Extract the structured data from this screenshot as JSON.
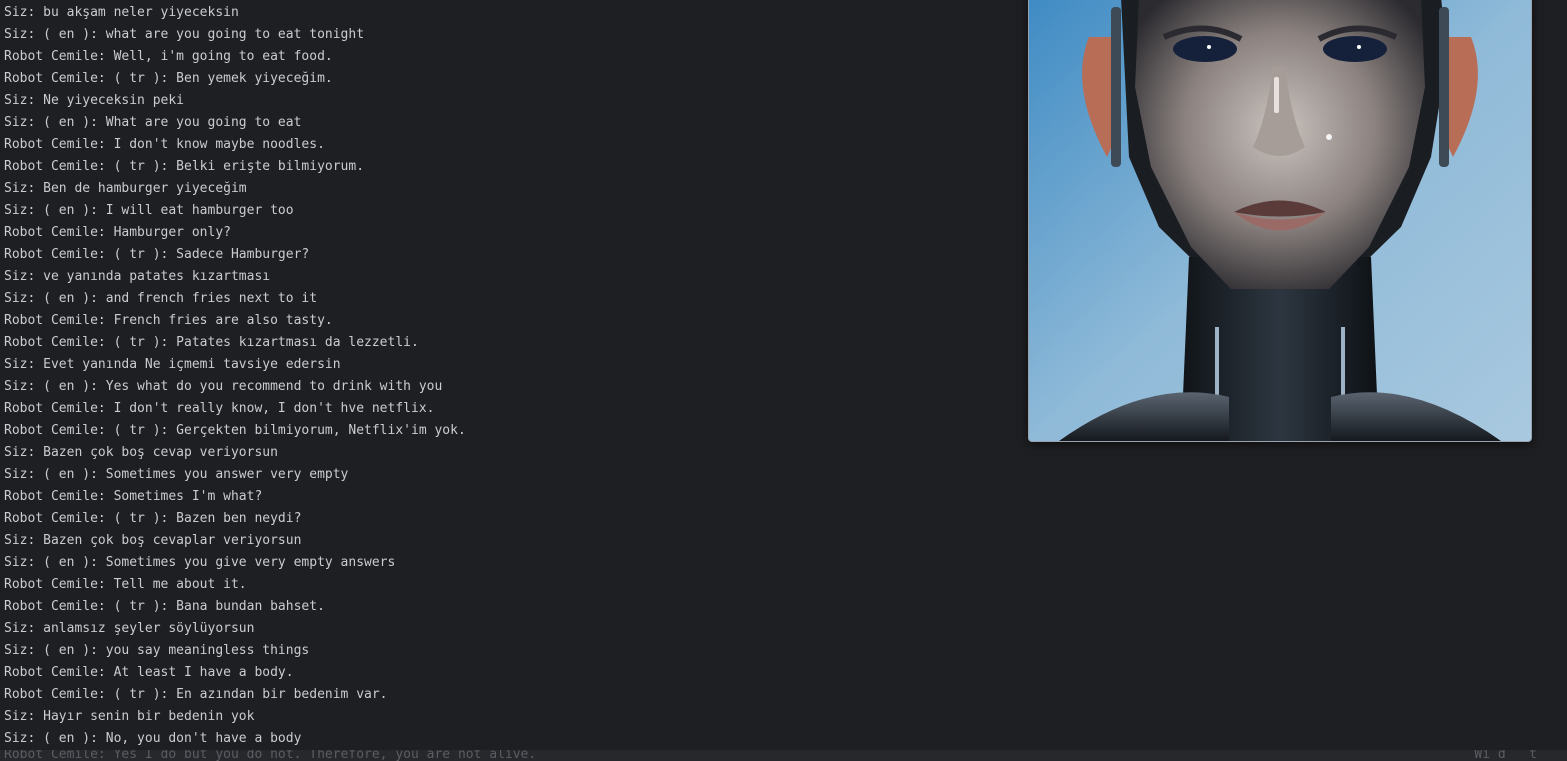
{
  "terminal": {
    "lines": [
      "Siz: bu akşam neler yiyeceksin",
      "Siz: ( en ): what are you going to eat tonight",
      "Robot Cemile: Well, i'm going to eat food.",
      "Robot Cemile: ( tr ): Ben yemek yiyeceğim.",
      "Siz: Ne yiyeceksin peki",
      "Siz: ( en ): What are you going to eat",
      "Robot Cemile: I don't know maybe noodles.",
      "Robot Cemile: ( tr ): Belki erişte bilmiyorum.",
      "Siz: Ben de hamburger yiyeceğim",
      "Siz: ( en ): I will eat hamburger too",
      "Robot Cemile: Hamburger only?",
      "Robot Cemile: ( tr ): Sadece Hamburger?",
      "Siz: ve yanında patates kızartması",
      "Siz: ( en ): and french fries next to it",
      "Robot Cemile: French fries are also tasty.",
      "Robot Cemile: ( tr ): Patates kızartması da lezzetli.",
      "Siz: Evet yanında Ne içmemi tavsiye edersin",
      "Siz: ( en ): Yes what do you recommend to drink with you",
      "Robot Cemile: I don't really know, I don't hve netflix.",
      "Robot Cemile: ( tr ): Gerçekten bilmiyorum, Netflix'im yok.",
      "Siz: Bazen çok boş cevap veriyorsun",
      "Siz: ( en ): Sometimes you answer very empty",
      "Robot Cemile: Sometimes I'm what?",
      "Robot Cemile: ( tr ): Bazen ben neydi?",
      "Siz: Bazen çok boş cevaplar veriyorsun",
      "Siz: ( en ): Sometimes you give very empty answers",
      "Robot Cemile: Tell me about it.",
      "Robot Cemile: ( tr ): Bana bundan bahset.",
      "Siz: anlamsız şeyler söylüyorsun",
      "Siz: ( en ): you say meaningless things",
      "Robot Cemile: At least I have a body.",
      "Robot Cemile: ( tr ): En azından bir bedenim var.",
      "Siz: Hayır senin bir bedenin yok",
      "Siz: ( en ): No, you don't have a body"
    ],
    "partial_line": "Robot Cemile: Yes I do but you do not. Therefore, you are not alive.",
    "status_right": "Wi d   t"
  },
  "image_window": {
    "image_icon": "robot-portrait-icon"
  },
  "colors": {
    "background": "#1e1f22",
    "text": "#c9ccd1",
    "dim_text": "#5a5d63",
    "image_sky": "#8fb5d6"
  }
}
